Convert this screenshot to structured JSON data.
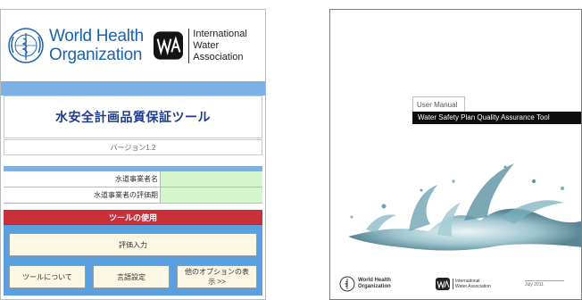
{
  "tool": {
    "who_name": "World Health Organization",
    "who_line1": "World Health",
    "who_line2": "Organization",
    "iwa_line1": "International",
    "iwa_line2": "Water Association",
    "title": "水安全計画品質保証ツール",
    "version": "バージョン1.2",
    "fields": [
      {
        "label": "水道事業者名",
        "value": ""
      },
      {
        "label": "水道事業者の評価期",
        "value": ""
      }
    ],
    "usage_header": "ツールの使用",
    "buttons": {
      "evaluate": "評価入力",
      "about": "ツールについて",
      "settings": "言語設定",
      "options": "他のオプションの表示 >>"
    }
  },
  "cover": {
    "label": "User Manual",
    "title": "Water Safety Plan Quality Assurance Tool",
    "footer_who_line1": "World Health",
    "footer_who_line2": "Organization",
    "footer_iwa_line1": "International",
    "footer_iwa_line2": "Water Association",
    "date": "July 2011"
  },
  "colors": {
    "who_blue": "#1b63b0",
    "band_blue": "#7db1e6",
    "panel_blue": "#5aa0e0",
    "header_red": "#c9303a",
    "field_green": "#d5f5cd",
    "button_cream": "#fbf7e3"
  }
}
